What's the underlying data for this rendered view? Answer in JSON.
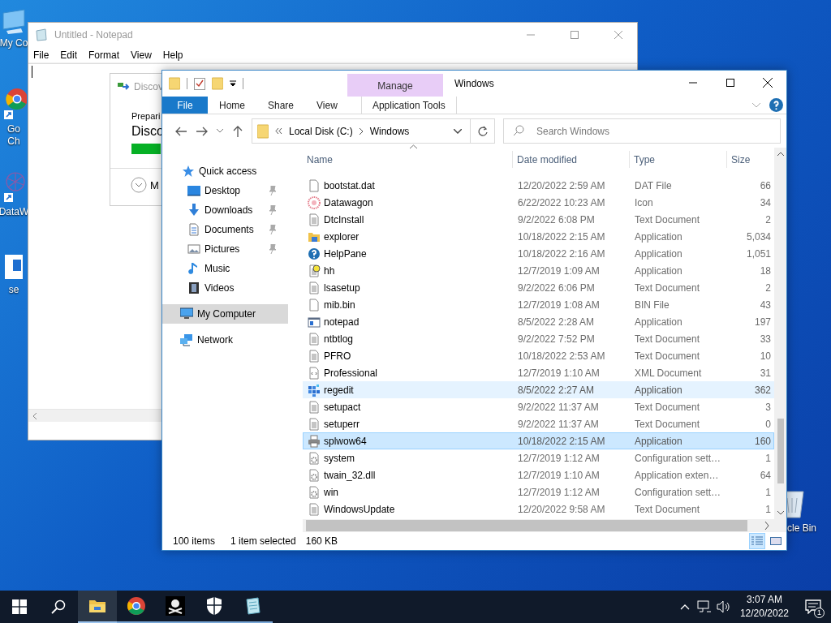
{
  "desktop": {
    "icons": [
      {
        "kind": "computer",
        "label_lines": [
          "My Co"
        ]
      },
      {
        "kind": "chrome",
        "label_lines": [
          "Go",
          "Ch"
        ]
      },
      {
        "kind": "datawagon",
        "label_lines": [
          "DataW"
        ]
      },
      {
        "kind": "document",
        "label_lines": [
          "se"
        ]
      },
      {
        "kind": "recycle-bin",
        "label_lines": [
          "cle Bin"
        ]
      }
    ]
  },
  "notepad": {
    "title": "Untitled - Notepad",
    "menu": [
      "File",
      "Edit",
      "Format",
      "View",
      "Help"
    ]
  },
  "dialog": {
    "title": "Discov",
    "status": "Prepari",
    "heading": "Disco",
    "more": "M",
    "progress": {
      "level": 1
    }
  },
  "explorer": {
    "title": "Windows",
    "context_tab": "Manage",
    "ribbon_tabs": [
      {
        "label": "File",
        "kind": "file"
      },
      {
        "label": "Home",
        "kind": "plain"
      },
      {
        "label": "Share",
        "kind": "plain"
      },
      {
        "label": "View",
        "kind": "plain"
      },
      {
        "label": "Application Tools",
        "kind": "context"
      }
    ],
    "address": {
      "path": [
        "Local Disk (C:)",
        "Windows"
      ]
    },
    "search": {
      "placeholder": "Search Windows"
    },
    "nav": [
      {
        "label": "Quick access",
        "kind": "star",
        "selected": false,
        "children": [
          {
            "label": "Desktop",
            "kind": "desktop",
            "pinned": true,
            "selected": false
          },
          {
            "label": "Downloads",
            "kind": "downloads",
            "pinned": true,
            "selected": false
          },
          {
            "label": "Documents",
            "kind": "documents",
            "pinned": true,
            "selected": false
          },
          {
            "label": "Pictures",
            "kind": "pictures",
            "pinned": true,
            "selected": false
          },
          {
            "label": "Music",
            "kind": "music",
            "pinned": false,
            "selected": false
          },
          {
            "label": "Videos",
            "kind": "videos",
            "pinned": false,
            "selected": false
          }
        ]
      },
      {
        "label": "My Computer",
        "kind": "computer",
        "selected": true
      },
      {
        "label": "Network",
        "kind": "network",
        "selected": false
      }
    ],
    "columns": [
      "Name",
      "Date modified",
      "Type",
      "Size"
    ],
    "rows": [
      {
        "kind": "blank",
        "name": "bootstat.dat",
        "date": "12/20/2022 2:59 AM",
        "type": "DAT File",
        "size": "66",
        "selected": false,
        "hovered": false
      },
      {
        "kind": "flower",
        "name": "Datawagon",
        "date": "6/22/2022 10:23 AM",
        "type": "Icon",
        "size": "34",
        "selected": false,
        "hovered": false
      },
      {
        "kind": "text",
        "name": "DtcInstall",
        "date": "9/2/2022 6:08 PM",
        "type": "Text Document",
        "size": "2",
        "selected": false,
        "hovered": false
      },
      {
        "kind": "folder-app",
        "name": "explorer",
        "date": "10/18/2022 2:15 AM",
        "type": "Application",
        "size": "5,034",
        "selected": false,
        "hovered": false
      },
      {
        "kind": "help",
        "name": "HelpPane",
        "date": "10/18/2022 2:16 AM",
        "type": "Application",
        "size": "1,051",
        "selected": false,
        "hovered": false
      },
      {
        "kind": "help-doc",
        "name": "hh",
        "date": "12/7/2019 1:09 AM",
        "type": "Application",
        "size": "18",
        "selected": false,
        "hovered": false
      },
      {
        "kind": "text",
        "name": "lsasetup",
        "date": "9/2/2022 6:06 PM",
        "type": "Text Document",
        "size": "2",
        "selected": false,
        "hovered": false
      },
      {
        "kind": "blank",
        "name": "mib.bin",
        "date": "12/7/2019 1:08 AM",
        "type": "BIN File",
        "size": "43",
        "selected": false,
        "hovered": false
      },
      {
        "kind": "window",
        "name": "notepad",
        "date": "8/5/2022 2:28 AM",
        "type": "Application",
        "size": "197",
        "selected": false,
        "hovered": false
      },
      {
        "kind": "text",
        "name": "ntbtlog",
        "date": "9/2/2022 7:52 PM",
        "type": "Text Document",
        "size": "33",
        "selected": false,
        "hovered": false
      },
      {
        "kind": "text",
        "name": "PFRO",
        "date": "10/18/2022 2:53 AM",
        "type": "Text Document",
        "size": "10",
        "selected": false,
        "hovered": false
      },
      {
        "kind": "xml",
        "name": "Professional",
        "date": "12/7/2019 1:10 AM",
        "type": "XML Document",
        "size": "31",
        "selected": false,
        "hovered": false
      },
      {
        "kind": "registry",
        "name": "regedit",
        "date": "8/5/2022 2:27 AM",
        "type": "Application",
        "size": "362",
        "selected": false,
        "hovered": true
      },
      {
        "kind": "text",
        "name": "setupact",
        "date": "9/2/2022 11:37 AM",
        "type": "Text Document",
        "size": "3",
        "selected": false,
        "hovered": false
      },
      {
        "kind": "text",
        "name": "setuperr",
        "date": "9/2/2022 11:37 AM",
        "type": "Text Document",
        "size": "0",
        "selected": false,
        "hovered": false
      },
      {
        "kind": "printer",
        "name": "splwow64",
        "date": "10/18/2022 2:15 AM",
        "type": "Application",
        "size": "160",
        "selected": true,
        "hovered": false
      },
      {
        "kind": "gear-doc",
        "name": "system",
        "date": "12/7/2019 1:12 AM",
        "type": "Configuration sett…",
        "size": "1",
        "selected": false,
        "hovered": false
      },
      {
        "kind": "gear-doc",
        "name": "twain_32.dll",
        "date": "12/7/2019 1:10 AM",
        "type": "Application exten…",
        "size": "64",
        "selected": false,
        "hovered": false
      },
      {
        "kind": "gear-doc",
        "name": "win",
        "date": "12/7/2019 1:12 AM",
        "type": "Configuration sett…",
        "size": "1",
        "selected": false,
        "hovered": false
      },
      {
        "kind": "text",
        "name": "WindowsUpdate",
        "date": "12/20/2022 9:58 AM",
        "type": "Text Document",
        "size": "1",
        "selected": false,
        "hovered": false
      }
    ],
    "status": {
      "items": "100 items",
      "selection": "1 item selected",
      "size": "160 KB"
    },
    "views": [
      {
        "kind": "details",
        "selected": true
      },
      {
        "kind": "large-icons",
        "selected": false
      }
    ]
  },
  "taskbar": {
    "apps": [
      {
        "kind": "explorer",
        "active": true
      },
      {
        "kind": "chrome",
        "active": false
      },
      {
        "kind": "pirate",
        "active": false
      },
      {
        "kind": "shield",
        "active": false
      },
      {
        "kind": "notepad",
        "active": false
      }
    ],
    "time": "3:07 AM",
    "date": "12/20/2022",
    "notifications": "1"
  }
}
